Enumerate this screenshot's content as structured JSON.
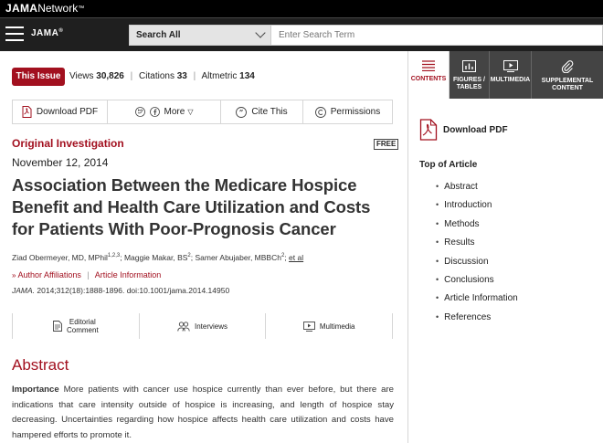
{
  "network": {
    "brand_bold": "JAMA",
    "brand_light": "Network",
    "trademark": "™"
  },
  "header": {
    "journal_logo": "JAMA",
    "journal_logo_mark": "®",
    "search_scope": "Search All",
    "search_placeholder": "Enter Search Term"
  },
  "metrics": {
    "issue_badge": "This Issue",
    "views_label": "Views",
    "views_value": "30,826",
    "citations_label": "Citations",
    "citations_value": "33",
    "altmetric_label": "Altmetric",
    "altmetric_value": "134"
  },
  "toolbar": {
    "download_pdf": "Download PDF",
    "more": "More",
    "cite": "Cite This",
    "permissions": "Permissions"
  },
  "article": {
    "type": "Original Investigation",
    "free_badge": "FREE",
    "date": "November 12, 2014",
    "title": "Association Between the Medicare Hospice Benefit and Health Care Utilization and Costs for Patients With Poor-Prognosis Cancer",
    "author1": "Ziad Obermeyer, MD, MPhil",
    "author1_sup": "1,2,3",
    "author2": "; Maggie Makar, BS",
    "author2_sup": "2",
    "author3": "; Samer Abujaber, MBBCh",
    "author3_sup": "2",
    "author_sep": "; ",
    "et_al": "et al",
    "affiliations_link": "Author Affiliations",
    "article_info_link": "Article Information",
    "citation_journal": "JAMA.",
    "citation_rest": " 2014;312(18):1888-1896. doi:10.1001/jama.2014.14950"
  },
  "resources": {
    "editorial_l1": "Editorial",
    "editorial_l2": "Comment",
    "interviews": "Interviews",
    "multimedia": "Multimedia"
  },
  "abstract": {
    "heading": "Abstract",
    "importance_label": "Importance",
    "importance_text": "  More patients with cancer use hospice currently than ever before, but there are indications that care intensity outside of hospice is increasing, and length of hospice stay decreasing. Uncertainties regarding how hospice affects health care utilization and costs have hampered efforts to promote it."
  },
  "sidebar": {
    "tabs": [
      {
        "label_l1": "CONTENTS",
        "label_l2": ""
      },
      {
        "label_l1": "FIGURES /",
        "label_l2": "TABLES"
      },
      {
        "label_l1": "MULTIMEDIA",
        "label_l2": ""
      },
      {
        "label_l1": "SUPPLEMENTAL",
        "label_l2": "CONTENT"
      }
    ],
    "download_pdf": "Download PDF",
    "toc_heading": "Top of Article",
    "toc": [
      "Abstract",
      "Introduction",
      "Methods",
      "Results",
      "Discussion",
      "Conclusions",
      "Article Information",
      "References"
    ]
  },
  "colors": {
    "accent": "#a2101f",
    "header_bg": "#1f1f1f",
    "tab_bg": "#444444"
  }
}
